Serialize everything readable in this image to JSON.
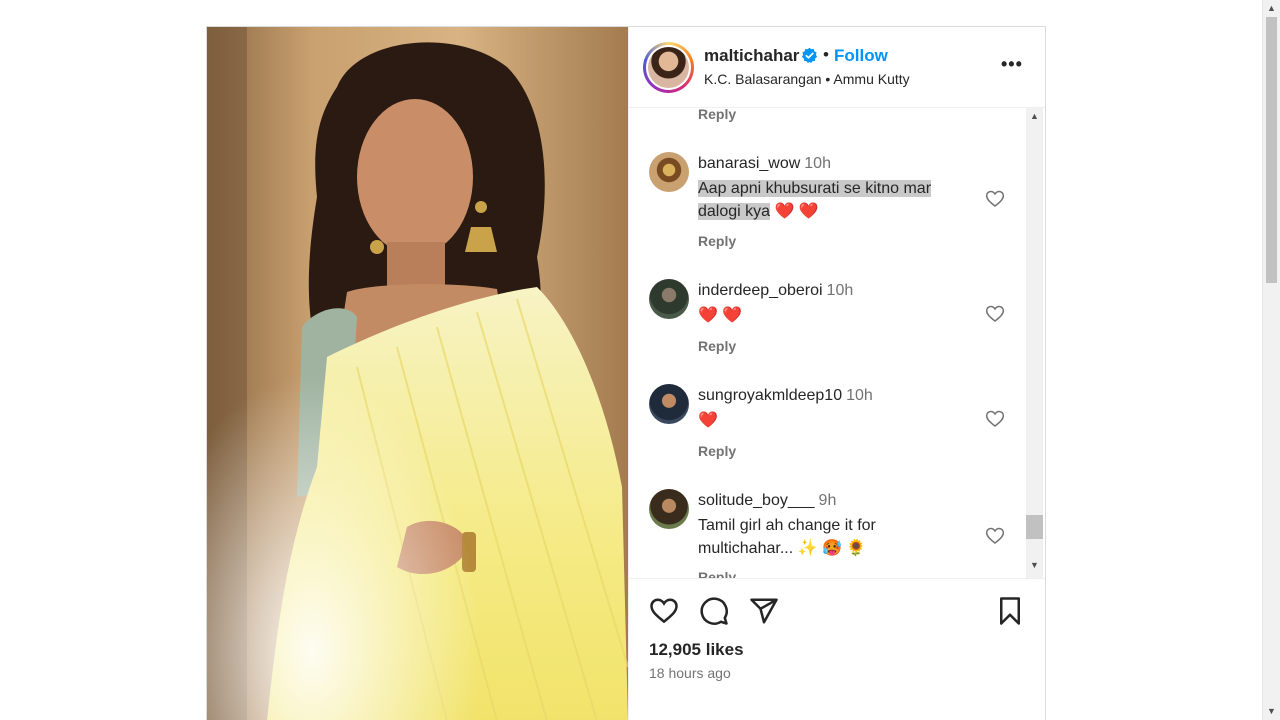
{
  "post": {
    "username": "maltichahar",
    "follow_label": "Follow",
    "separator": "•",
    "location": "K.C. Balasarangan • Ammu Kutty",
    "more_label": "•••"
  },
  "comments": {
    "top_reply": "Reply",
    "items": [
      {
        "user": "banarasi_wow",
        "time": "10h",
        "text_highlighted": "Aap apni khubsurati se kitno mar dalogi kya",
        "text_rest": " ❤️ ❤️",
        "reply": "Reply"
      },
      {
        "user": "inderdeep_oberoi",
        "time": "10h",
        "text": "❤️ ❤️",
        "reply": "Reply"
      },
      {
        "user": "sungroyakmldeep10",
        "time": "10h",
        "text": "❤️",
        "reply": "Reply"
      },
      {
        "user": "solitude_boy___",
        "time": "9h",
        "text": "Tamil girl ah change it for multichahar... ✨ 🥵 🌻",
        "reply": "Reply"
      }
    ]
  },
  "footer": {
    "likes": "12,905 likes",
    "time_ago": "18 hours ago"
  },
  "icons": {
    "like": "heart-icon",
    "comment": "comment-bubble-icon",
    "share": "paper-plane-icon",
    "save": "bookmark-icon",
    "verified": "verified-badge-icon"
  },
  "colors": {
    "accent": "#0095f6",
    "text": "#262626",
    "muted": "#737373",
    "highlight": "#c9c9c9"
  }
}
